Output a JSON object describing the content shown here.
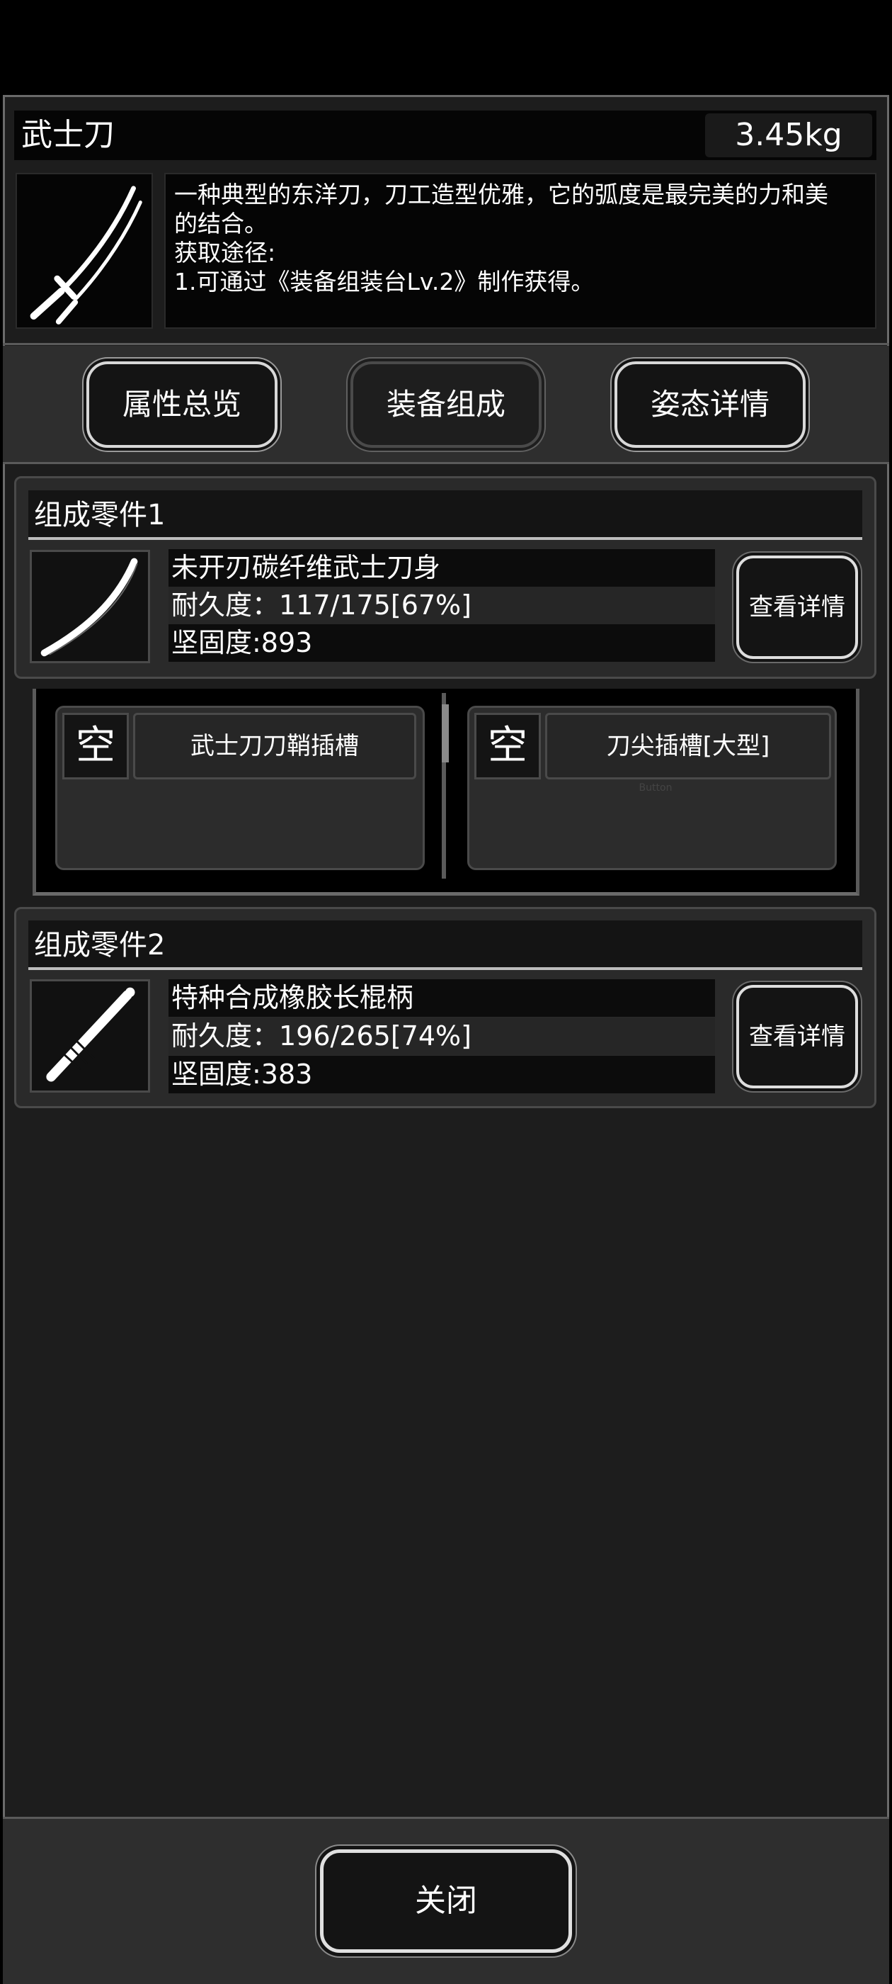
{
  "item": {
    "name": "武士刀",
    "weight": "3.45kg",
    "image_icon": "katana-icon",
    "description": [
      "一种典型的东洋刀，刀工造型优雅，它的弧度是最完美的力和美",
      "的结合。",
      "获取途径:",
      "1.可通过《装备组装台Lv.2》制作获得。"
    ]
  },
  "tabs": [
    {
      "label": "属性总览"
    },
    {
      "label": "装备组成"
    },
    {
      "label": "姿态详情"
    }
  ],
  "components": [
    {
      "title": "组成零件1",
      "name": "未开刃碳纤维武士刀身",
      "durability": "耐久度：117/175[67%]",
      "hardness": "坚固度:893",
      "detail_label": "查看详情",
      "icon": "blade-icon"
    },
    {
      "title": "组成零件2",
      "name": "特种合成橡胶长棍柄",
      "durability": "耐久度：196/265[74%]",
      "hardness": "坚固度:383",
      "detail_label": "查看详情",
      "icon": "handle-icon"
    }
  ],
  "slots": [
    {
      "status": "空",
      "name": "武士刀刀鞘插槽"
    },
    {
      "status": "空",
      "name": "刀尖插槽[大型]",
      "hint": "Button"
    }
  ],
  "footer": {
    "close_label": "关闭"
  }
}
